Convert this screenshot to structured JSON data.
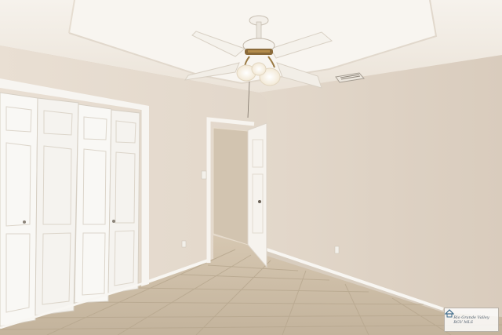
{
  "watermark": {
    "line1": "Rio Grande Valley",
    "line2": "RGV MLS"
  },
  "colors": {
    "ceiling": "#f4efe8",
    "tray": "#ece5dc",
    "wall_left": "#e6dcd0",
    "wall_right": "#ddd1c3",
    "trim": "#f7f5f1",
    "floor": "#cbbda8",
    "tile_line": "#b9a98f"
  }
}
